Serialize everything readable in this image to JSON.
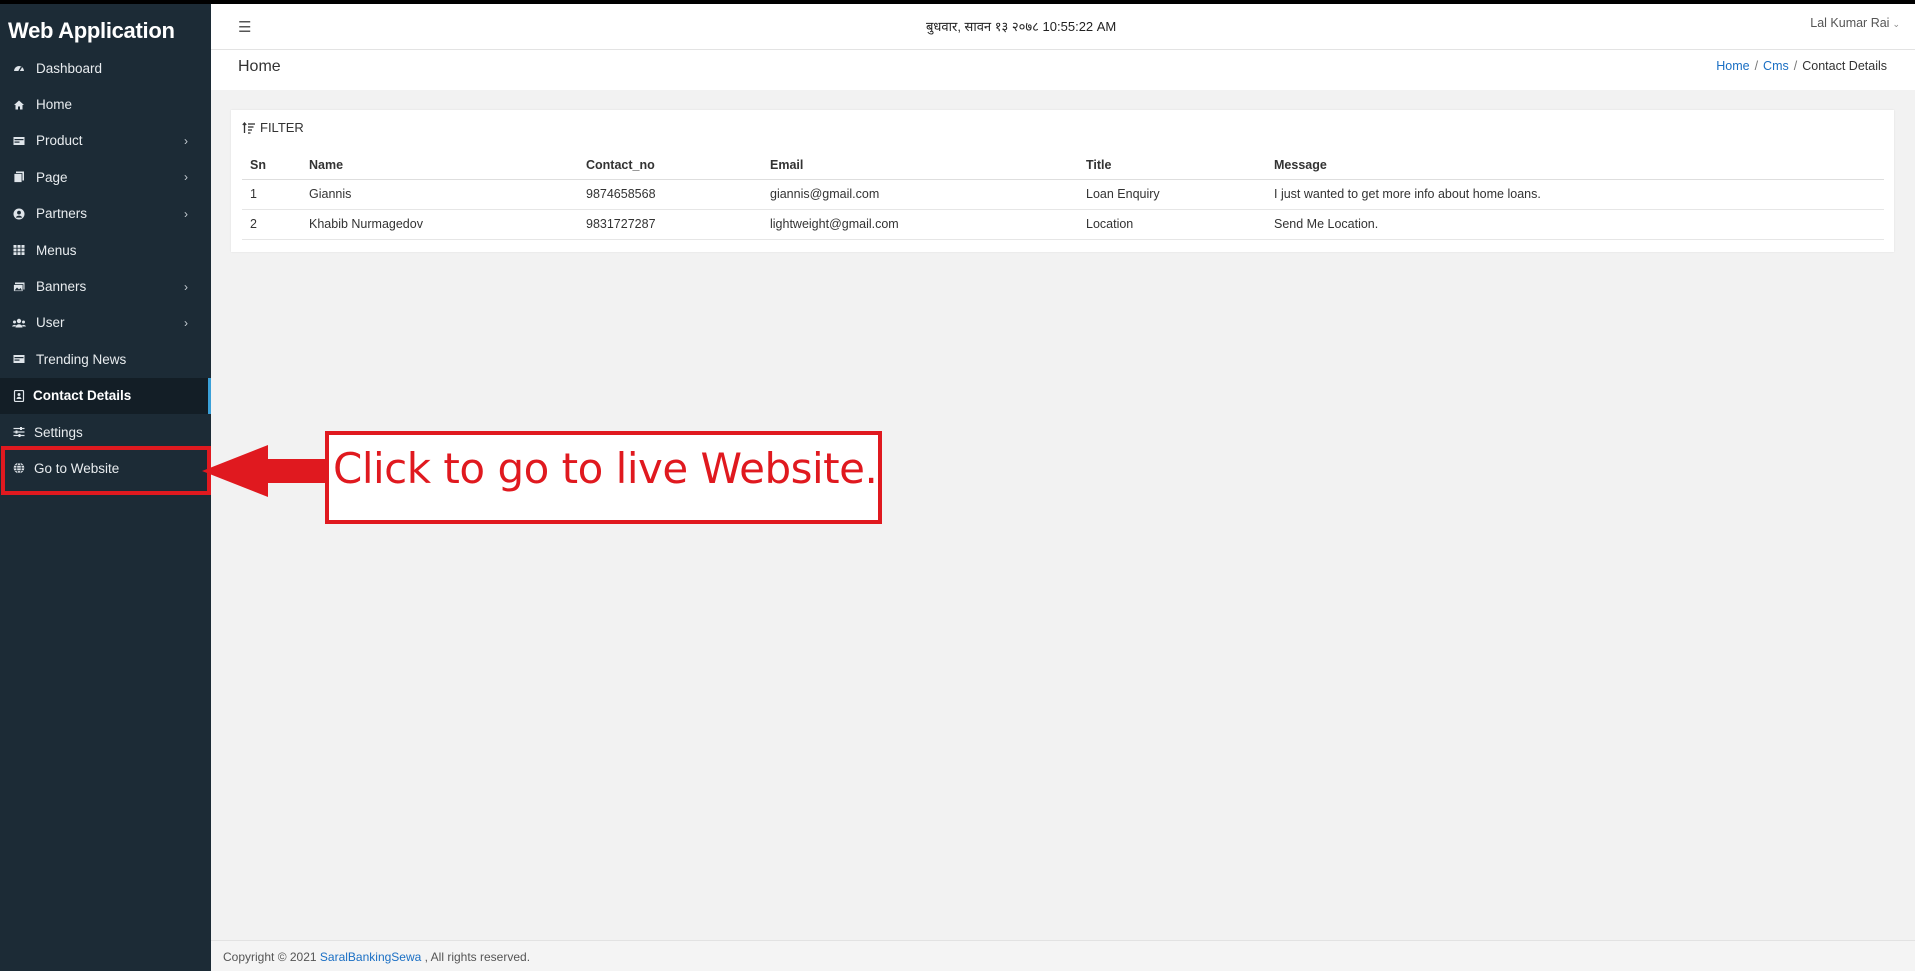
{
  "app": {
    "title": "Web Application"
  },
  "sidebar": {
    "items": [
      {
        "label": "Dashboard",
        "icon": "dashboard-icon",
        "has_children": false
      },
      {
        "label": "Home",
        "icon": "home-icon",
        "has_children": false
      },
      {
        "label": "Product",
        "icon": "product-icon",
        "has_children": true
      },
      {
        "label": "Page",
        "icon": "page-icon",
        "has_children": true
      },
      {
        "label": "Partners",
        "icon": "partners-icon",
        "has_children": true
      },
      {
        "label": "Menus",
        "icon": "grid-icon",
        "has_children": false
      },
      {
        "label": "Banners",
        "icon": "image-icon",
        "has_children": true
      },
      {
        "label": "User",
        "icon": "users-icon",
        "has_children": true
      },
      {
        "label": "Trending News",
        "icon": "news-icon",
        "has_children": false
      },
      {
        "label": "Contact Details",
        "icon": "contact-icon",
        "has_children": false,
        "active": true
      },
      {
        "label": "Settings",
        "icon": "sliders-icon",
        "has_children": false
      },
      {
        "label": "Go to Website",
        "icon": "globe-icon",
        "has_children": false
      }
    ]
  },
  "header": {
    "datetime": "बुधवार, सावन १३ २०७८ 10:55:22 AM",
    "user_name": "Lal Kumar Rai"
  },
  "titlebar": {
    "page_title": "Home",
    "breadcrumb": [
      "Home",
      "Cms",
      "Contact Details"
    ]
  },
  "filter": {
    "label": "FILTER"
  },
  "table": {
    "columns": [
      "Sn",
      "Name",
      "Contact_no",
      "Email",
      "Title",
      "Message"
    ],
    "rows": [
      [
        "1",
        "Giannis",
        "9874658568",
        "giannis@gmail.com",
        "Loan Enquiry",
        "I just wanted to get more info about home loans."
      ],
      [
        "2",
        "Khabib Nurmagedov",
        "9831727287",
        "lightweight@gmail.com",
        "Location",
        "Send Me Location."
      ]
    ]
  },
  "footer": {
    "prefix": "Copyright © 2021 ",
    "link": "SaralBankingSewa",
    "suffix": " , All rights reserved."
  },
  "annotation": {
    "text": "Click to go to live Website.",
    "color": "#e0191f"
  },
  "colors": {
    "sidebar_bg": "#1c2b36",
    "active_accent": "#3aa0d8",
    "link": "#1a6fc4"
  }
}
